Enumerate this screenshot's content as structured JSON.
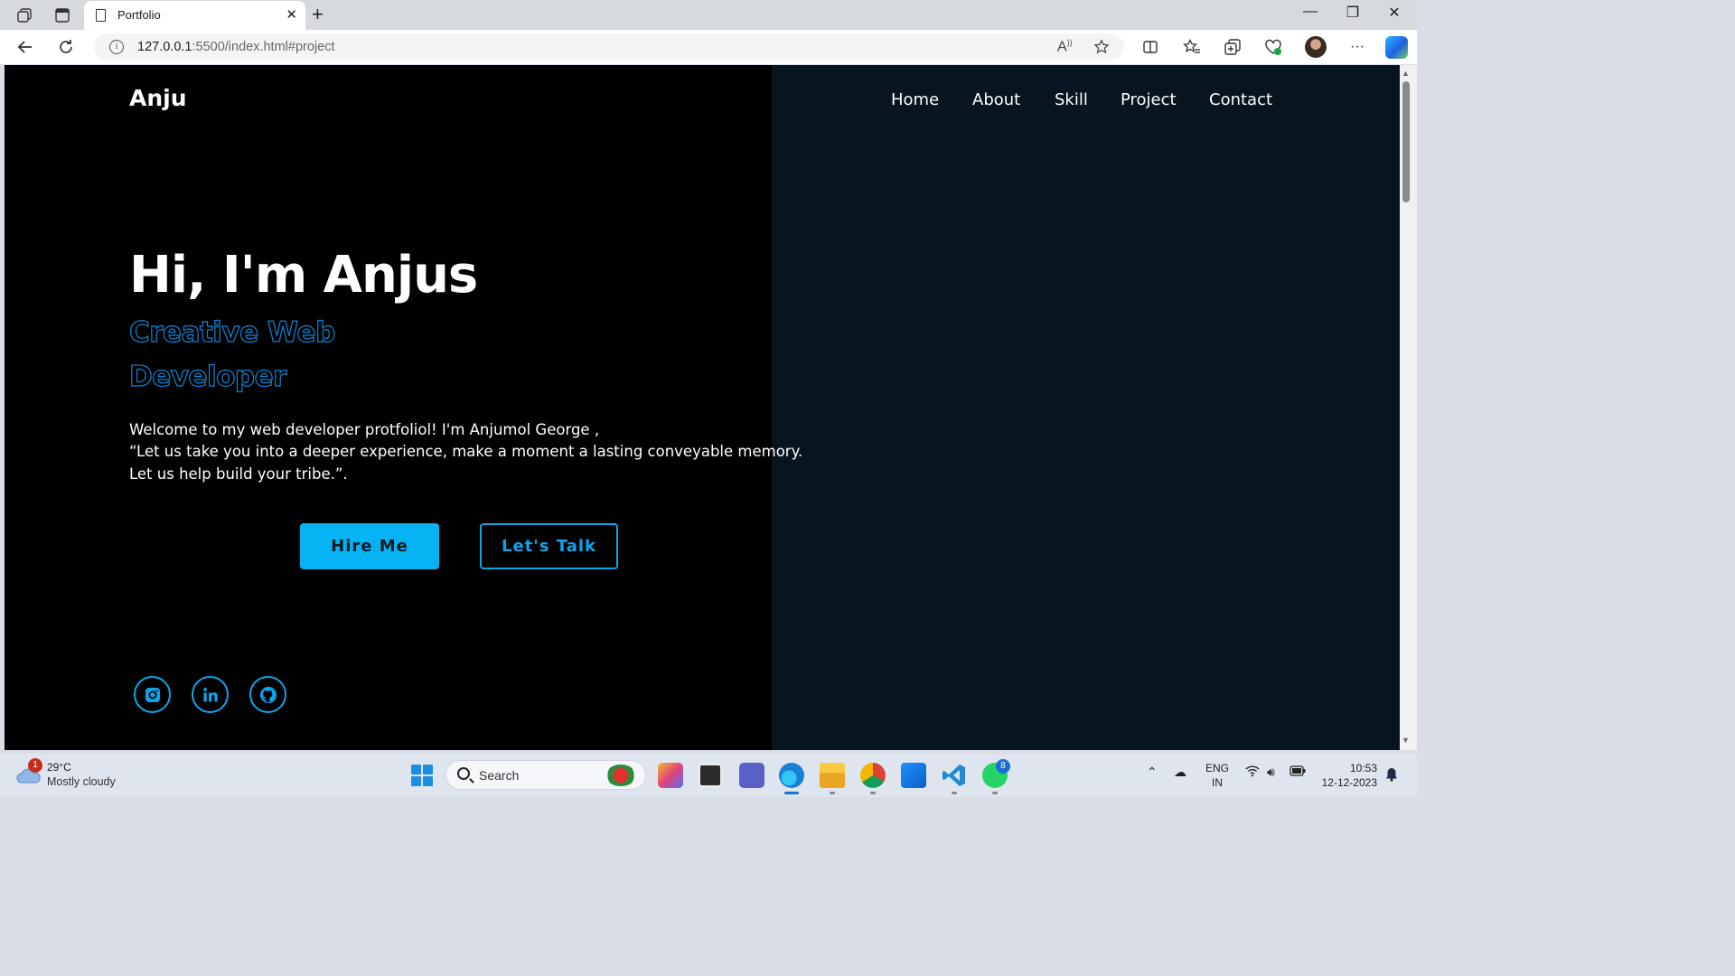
{
  "browser": {
    "tab_title": "Portfolio",
    "tab_close": "✕",
    "new_tab": "+",
    "url_host": "127.0.0.1",
    "url_path": ":5500/index.html#project",
    "window_controls": {
      "minimize": "—",
      "restore": "❐",
      "close": "✕"
    }
  },
  "nav": {
    "brand": "Anju",
    "items": [
      {
        "label": "Home"
      },
      {
        "label": "About"
      },
      {
        "label": "Skill"
      },
      {
        "label": "Project"
      },
      {
        "label": "Contact"
      }
    ]
  },
  "hero": {
    "title": "Hi, I'm Anjus",
    "subtitle_line1": "Creative Web",
    "subtitle_line2": "Developer",
    "intro_line1": "Welcome to my web developer protfoliol! I'm Anjumol George ,",
    "intro_line2": "“Let us take you into a deeper experience, make a moment a lasting conveyable memory.",
    "intro_line3": "Let us help build your tribe.”.",
    "hire_button": "Hire Me",
    "talk_button": "Let's Talk"
  },
  "social": [
    {
      "icon": "instagram-icon"
    },
    {
      "icon": "linkedin-icon"
    },
    {
      "icon": "github-icon"
    }
  ],
  "taskbar": {
    "weather_badge": "1",
    "weather_temp": "29°C",
    "weather_desc": "Mostly cloudy",
    "search_placeholder": "Search",
    "teams_badge": "",
    "whatsapp_badge": "8",
    "lang_line1": "ENG",
    "lang_line2": "IN",
    "time": "10:53",
    "date": "12-12-2023"
  },
  "colors": {
    "accent": "#05b3f3",
    "outline": "#0a86d8",
    "panel": "#061520",
    "background": "#000000"
  }
}
